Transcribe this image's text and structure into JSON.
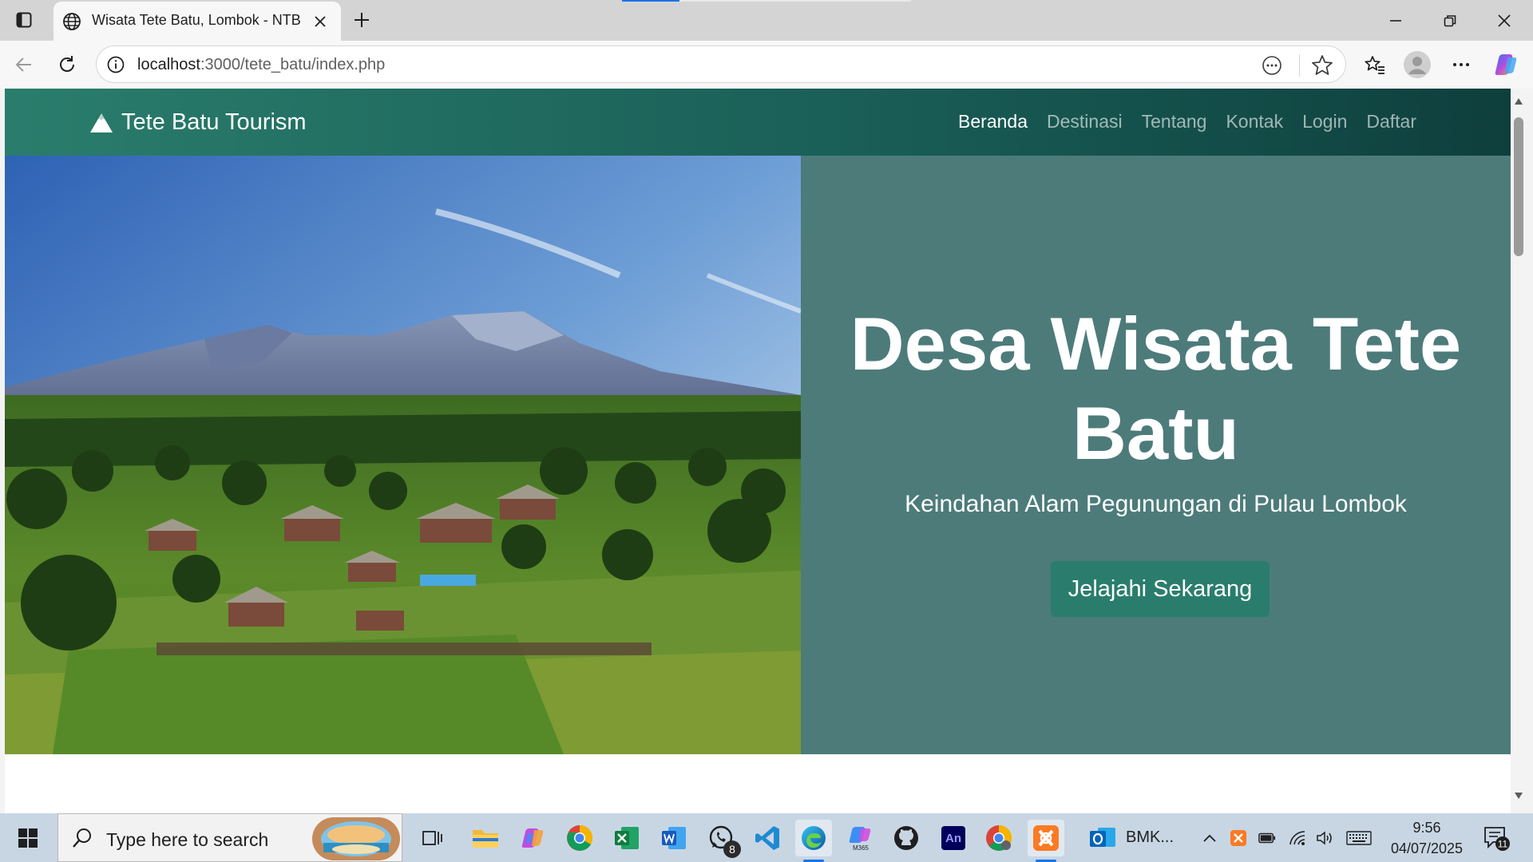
{
  "browser": {
    "tab": {
      "title": "Wisata Tete Batu, Lombok - NTB"
    },
    "address": {
      "host": "localhost",
      "path": ":3000/tete_batu/index.php"
    }
  },
  "page": {
    "brand": "Tete Batu Tourism",
    "nav": [
      "Beranda",
      "Destinasi",
      "Tentang",
      "Kontak",
      "Login",
      "Daftar"
    ],
    "active_nav": "Beranda",
    "hero": {
      "title_line1": "Desa Wisata Tete",
      "title_line2": "Batu",
      "subtitle": "Keindahan Alam Pegunungan di Pulau Lombok",
      "cta": "Jelajahi Sekarang"
    }
  },
  "taskbar": {
    "search_placeholder": "Type here to search",
    "whatsapp_badge": "8",
    "m365_label": "M365",
    "outlook_label": "BMK...",
    "time": "9:56",
    "date": "04/07/2025",
    "notifications": "11"
  },
  "colors": {
    "navbar_start": "#2a7d6c",
    "navbar_end": "#0e3f3d",
    "hero_panel": "#4c7b7a",
    "button": "#2a7d6c"
  }
}
